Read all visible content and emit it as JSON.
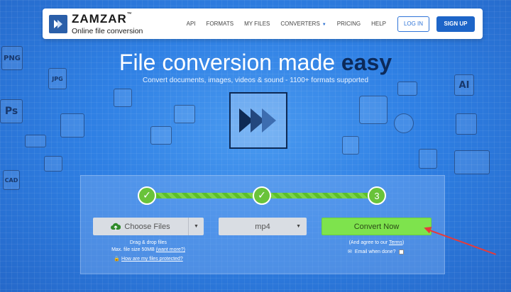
{
  "brand": {
    "name": "ZAMZAR",
    "tm": "™",
    "tagline": "Online file conversion"
  },
  "nav": {
    "links": [
      "API",
      "FORMATS",
      "MY FILES",
      "CONVERTERS",
      "PRICING",
      "HELP"
    ],
    "login": "LOG IN",
    "signup": "SIGN UP"
  },
  "hero": {
    "title_plain": "File conversion made ",
    "title_bold": "easy",
    "subtitle": "Convert documents, images, videos & sound - 1100+ formats supported"
  },
  "steps": {
    "step1_symbol": "✓",
    "step2_symbol": "✓",
    "step3_label": "3"
  },
  "controls": {
    "choose_files": "Choose Files",
    "format_value": "mp4",
    "convert": "Convert Now"
  },
  "help": {
    "drag_drop": "Drag & drop files",
    "max_size": "Max. file size 50MB",
    "want_more": "(want more?)",
    "protected": "How are my files protected?",
    "agree_prefix": "(And agree to our ",
    "terms": "Terms",
    "agree_suffix": ")",
    "email_when_done": "Email when done?"
  },
  "doodles": [
    "PNG",
    "JPG",
    "Ps",
    "CAD",
    "AI"
  ],
  "colors": {
    "background": "#2f7de0",
    "convert_button": "#7ee34d",
    "signup_button": "#1d65c8",
    "annotation_arrow": "#e63b3b"
  }
}
